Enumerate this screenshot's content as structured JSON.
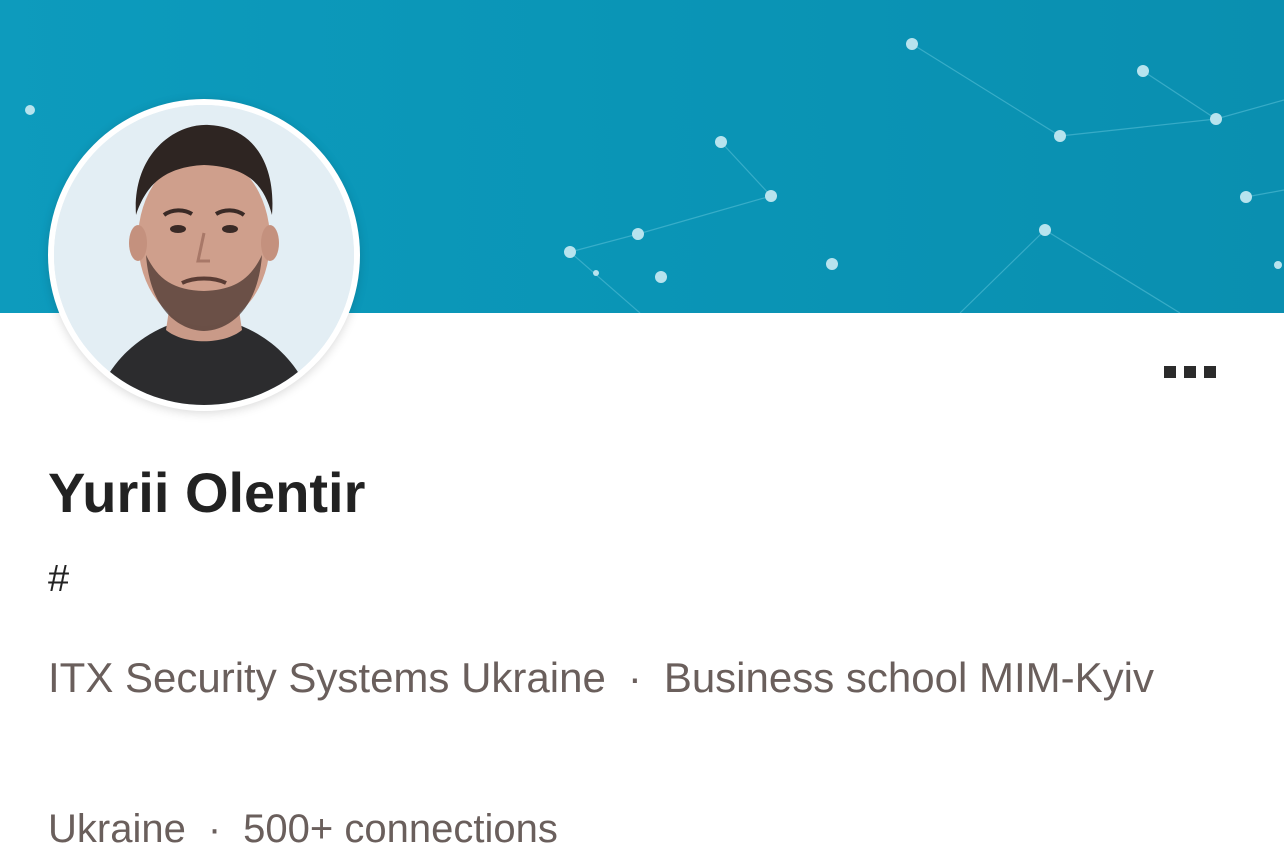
{
  "profile": {
    "name": "Yurii Olentir",
    "headline": "#",
    "company": "ITX Security Systems Ukraine",
    "school": "Business school MIM-Kyiv",
    "separator": "·",
    "location": "Ukraine",
    "connections": "500+ connections"
  },
  "banner": {
    "color": "#0a95b6"
  },
  "icons": {
    "more": "more-horizontal-icon"
  }
}
